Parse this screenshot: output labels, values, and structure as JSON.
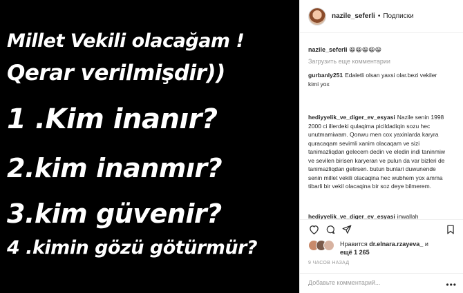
{
  "post_image": {
    "lines": [
      "Millet Vekili olacağam !",
      "Qerar verilmişdir))",
      "1 .Kim inanır?",
      "2.kim inanmır?",
      "3.kim güvenir?",
      "4 .kimin gözü götürmür?"
    ]
  },
  "header": {
    "username": "nazile_seferli",
    "separator": "•",
    "follow_label": "Подписки"
  },
  "caption": {
    "username": "nazile_seferli",
    "text": "😀😀😀😀😀"
  },
  "load_more": "Загрузить еще комментарии",
  "comments": [
    {
      "username": "gurbanly251",
      "text": "Edaletli olsan yaxsi olar.bezi vekiler kimi yox"
    },
    {
      "username": "hediyyelik_ve_diger_ev_esyasi",
      "text": "Nazile senin 1998 2000 ci illerdeki qulaqima picildadiqin sozu hec unutmamiwam. Qonwu men cox yaxinlarda karyra quracaqam sevimli xanim olacaqam ve sizi tanimazliqdan gelecem dedin ve eledin indi taninmiw ve sevilen birisen karyeran ve pulun da var bizleri de tanimazliqdan gelirsen. butun bunlari duwunende senin millet vekili olacaqina hec wubhem yox amma tibarli bir vekil olacaqina bir soz deye bilmerem."
    },
    {
      "username": "hediyyelik_ve_diger_ev_esyasi",
      "text": "inwallah"
    }
  ],
  "likes": {
    "prefix": "Нравится",
    "user": "dr.elnara.rzayeva_",
    "and": "и",
    "count_text": "ещё 1 265"
  },
  "time": "9 ЧАСОВ НАЗАД",
  "add_comment": {
    "placeholder": "Добавьте комментарий...",
    "more": "•••"
  },
  "icons": {
    "like": "heart-icon",
    "comment": "comment-icon",
    "share": "share-icon",
    "save": "bookmark-icon"
  }
}
